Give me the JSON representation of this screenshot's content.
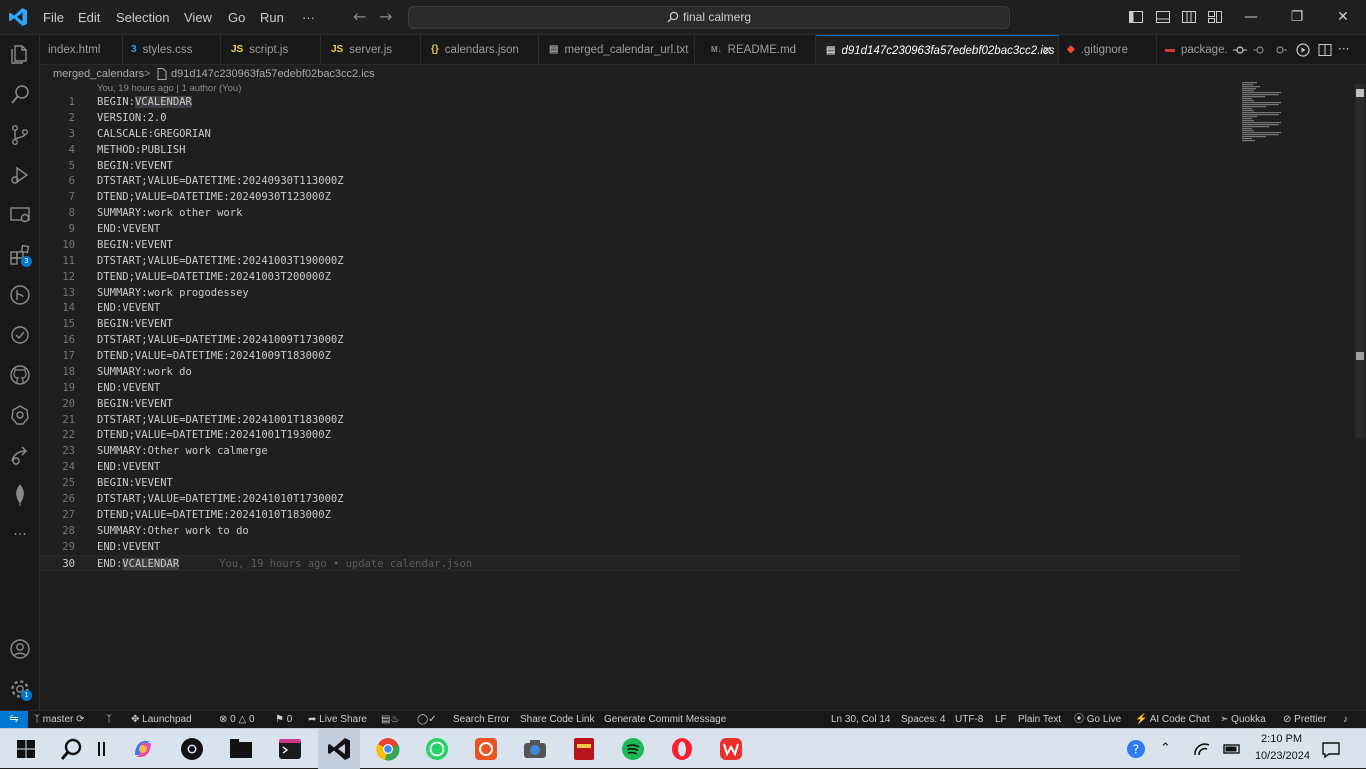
{
  "menu": {
    "file": "File",
    "edit": "Edit",
    "selection": "Selection",
    "view": "View",
    "go": "Go",
    "run": "Run",
    "more": "···"
  },
  "command_center": {
    "search_text": "final calmerg"
  },
  "tabs": [
    {
      "label": "index.html",
      "icon": "html-file-icon"
    },
    {
      "label": "styles.css",
      "icon": "css-file-icon"
    },
    {
      "label": "script.js",
      "icon": "js-file-icon"
    },
    {
      "label": "server.js",
      "icon": "js-file-icon"
    },
    {
      "label": "calendars.json",
      "icon": "json-file-icon"
    },
    {
      "label": "merged_calendar_url.txt",
      "icon": "text-file-icon"
    },
    {
      "label": "README.md",
      "icon": "markdown-file-icon"
    },
    {
      "label": "d91d147c230963fa57edebf02bac3cc2.ics",
      "icon": "ics-file-icon",
      "active": true
    },
    {
      "label": ".gitignore",
      "icon": "git-file-icon"
    },
    {
      "label": "package.",
      "icon": "npm-file-icon"
    }
  ],
  "breadcrumb": {
    "folder": "merged_calendars",
    "separator": ">",
    "file": "d91d147c230963fa57edebf02bac3cc2.ics"
  },
  "codelens": "You, 19 hours ago | 1 author (You)",
  "lines": [
    "BEGIN:VCALENDAR",
    "VERSION:2.0",
    "CALSCALE:GREGORIAN",
    "METHOD:PUBLISH",
    "BEGIN:VEVENT",
    "DTSTART;VALUE=DATETIME:20240930T113000Z",
    "DTEND;VALUE=DATETIME:20240930T123000Z",
    "SUMMARY:work other work",
    "END:VEVENT",
    "BEGIN:VEVENT",
    "DTSTART;VALUE=DATETIME:20241003T190000Z",
    "DTEND;VALUE=DATETIME:20241003T200000Z",
    "SUMMARY:work progodessey",
    "END:VEVENT",
    "BEGIN:VEVENT",
    "DTSTART;VALUE=DATETIME:20241009T173000Z",
    "DTEND;VALUE=DATETIME:20241009T183000Z",
    "SUMMARY:work do",
    "END:VEVENT",
    "BEGIN:VEVENT",
    "DTSTART;VALUE=DATETIME:20241001T183000Z",
    "DTEND;VALUE=DATETIME:20241001T193000Z",
    "SUMMARY:Other work calmerge",
    "END:VEVENT",
    "BEGIN:VEVENT",
    "DTSTART;VALUE=DATETIME:20241010T173000Z",
    "DTEND;VALUE=DATETIME:20241010T183000Z",
    "SUMMARY:Other work to do",
    "END:VEVENT",
    "END:VCALENDAR"
  ],
  "blame_inline": "You, 19 hours ago • update calendar.json",
  "activity_badges": {
    "extensions": "3",
    "settings": "1"
  },
  "status": {
    "branch": "master",
    "launchpad": "Launchpad",
    "errors": "0",
    "warnings": "0",
    "info": "0",
    "live_share": "Live Share",
    "search_error": "Search Error",
    "share_code_link": "Share Code Link",
    "generate_commit": "Generate Commit Message",
    "cursor": "Ln 30, Col 14",
    "spaces": "Spaces: 4",
    "encoding": "UTF-8",
    "eol": "LF",
    "language": "Plain Text",
    "go_live": "Go Live",
    "ai_chat": "AI Code Chat",
    "quokka": "Quokka",
    "prettier": "Prettier"
  },
  "tray": {
    "time": "2:10 PM",
    "date": "10/23/2024"
  },
  "colors": {
    "accent": "#0078d4",
    "editor_bg": "#1f1f1f",
    "sidebar_bg": "#181818",
    "taskbar_bg": "#d9e3ee"
  }
}
